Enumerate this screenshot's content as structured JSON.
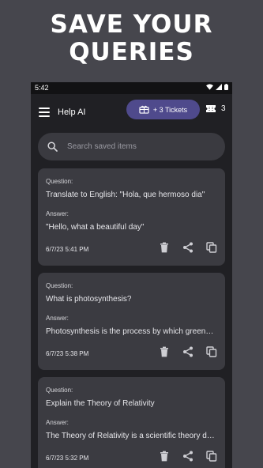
{
  "promo": {
    "line1": "SAVE YOUR",
    "line2": "QUERIES"
  },
  "status_bar": {
    "time": "5:42"
  },
  "app_bar": {
    "title": "Help AI",
    "tickets_button_label": "+ 3 Tickets",
    "ticket_count": "3",
    "menu_icon": "hamburger-menu-icon",
    "ticket_icon": "ticket-icon"
  },
  "search": {
    "placeholder": "Search saved items",
    "icon": "search-icon"
  },
  "colors": {
    "accent": "#4f4a8c",
    "card": "#3b3b41",
    "background": "#202024"
  },
  "items": [
    {
      "question_label": "Question:",
      "question": "Translate to English: \"Hola, que hermoso dia\"",
      "answer_label": "Answer:",
      "answer": "\"Hello, what a beautiful day\"",
      "date": "6/7/23 5:41 PM"
    },
    {
      "question_label": "Question:",
      "question": "What is photosynthesis?",
      "answer_label": "Answer:",
      "answer": "Photosynthesis is the process by which green plants use sunlight to synthesize foods",
      "date": "6/7/23 5:38 PM"
    },
    {
      "question_label": "Question:",
      "question": "Explain the Theory of Relativity",
      "answer_label": "Answer:",
      "answer": "The Theory of Relativity is a scientific theory developed by Albert Einstein",
      "date": "6/7/23 5:32 PM"
    }
  ]
}
